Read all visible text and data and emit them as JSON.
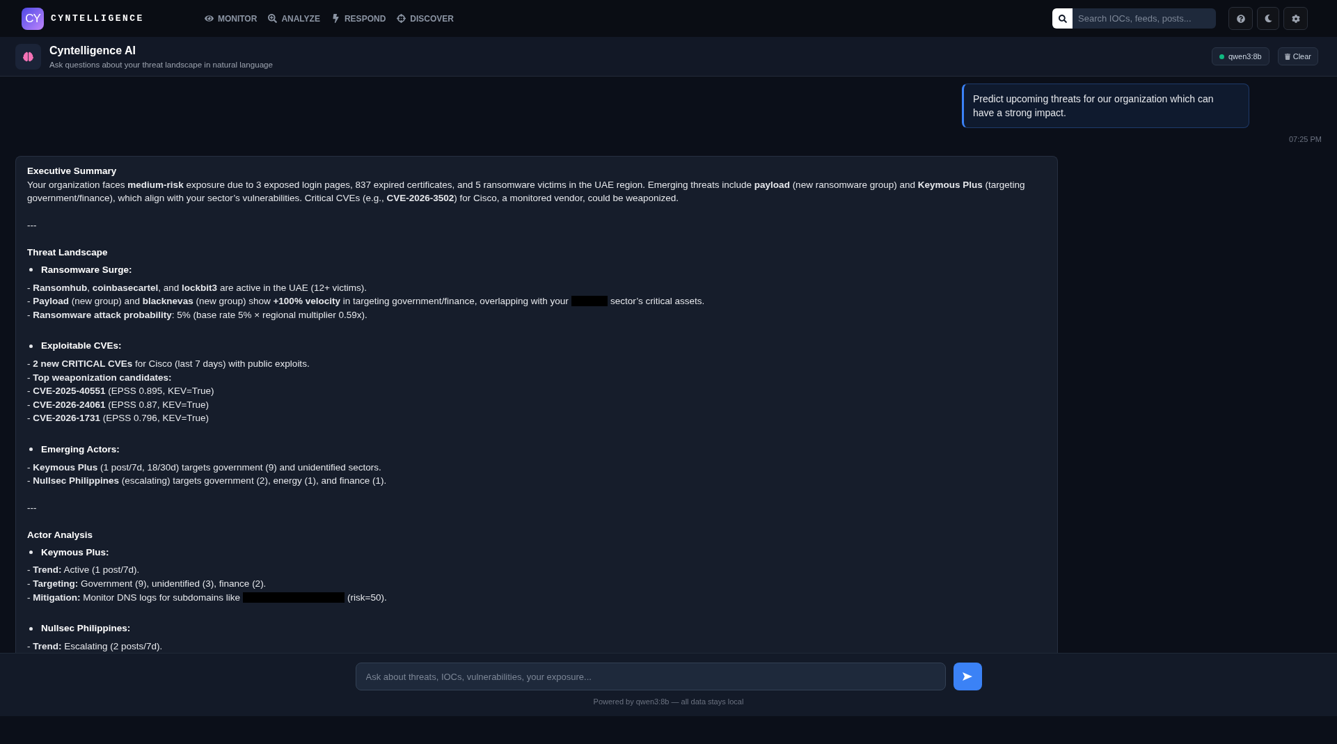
{
  "nav": {
    "logo_text": "CY",
    "brand": "CYNTELLIGENCE",
    "items": [
      {
        "label": "MONITOR"
      },
      {
        "label": "ANALYZE"
      },
      {
        "label": "RESPOND"
      },
      {
        "label": "DISCOVER"
      }
    ],
    "search": {
      "placeholder": "Search IOCs, feeds, posts..."
    }
  },
  "assistant_header": {
    "title": "Cyntelligence AI",
    "subtitle": "Ask questions about your threat landscape in natural language",
    "model_badge": {
      "label": "qwen3:8b",
      "online": true
    },
    "clear_button": "Clear"
  },
  "chat": {
    "messages": [
      {
        "kind": "user",
        "text": "Predict upcoming threats for our organization which can have a strong impact.",
        "time": "07:25 PM"
      },
      {
        "kind": "assistant",
        "blocks": [
          {
            "kind": "heading",
            "text": "Executive Summary"
          },
          {
            "kind": "paragraph",
            "text": "Your organization faces **medium-risk** exposure due to 3 exposed login pages, 837 expired certificates, and 5 ransomware victims in the UAE region. Emerging threats include **payload** (new ransomware group) and **Keymous Plus** (targeting government/finance), which align with your sector’s vulnerabilities. Critical CVEs (e.g., **CVE-2026-3502**) for Cisco, a monitored vendor, could be weaponized."
          },
          {
            "kind": "rule",
            "text": "---"
          },
          {
            "kind": "heading",
            "text": "Threat Landscape"
          },
          {
            "kind": "bullet",
            "text": "Ransomware Surge:"
          },
          {
            "kind": "lines",
            "lines": [
              {
                "text": "- **Ransomhub**, **coinbasecartel**, and **lockbit3** are active in the UAE (12+ victims)."
              },
              {
                "text": "- **Payload** (new group) and **blacknevas** (new group) show **+100% velocity** in targeting government/finance, overlapping with your",
                "redacted": true,
                "after": "sector’s critical assets."
              },
              {
                "text": "- **Ransomware attack probability**: 5% (base rate 5% × regional multiplier 0.59x)."
              }
            ]
          },
          {
            "kind": "bullet",
            "text": "Exploitable CVEs:"
          },
          {
            "kind": "lines",
            "lines": [
              {
                "text": "- **2 new CRITICAL CVEs** for Cisco (last 7 days) with public exploits."
              },
              {
                "text": "- **Top weaponization candidates:**"
              },
              {
                "text": "- **CVE-2025-40551** (EPSS 0.895, KEV=True)"
              },
              {
                "text": "- **CVE-2026-24061** (EPSS 0.87, KEV=True)"
              },
              {
                "text": "- **CVE-2026-1731** (EPSS 0.796, KEV=True)"
              }
            ]
          },
          {
            "kind": "bullet",
            "text": "Emerging Actors:"
          },
          {
            "kind": "lines",
            "lines": [
              {
                "text": "- **Keymous Plus** (1 post/7d, 18/30d) targets government (9) and unidentified sectors."
              },
              {
                "text": "- **Nullsec Philippines** (escalating) targets government (2), energy (1), and finance (1)."
              }
            ]
          },
          {
            "kind": "rule",
            "text": "---"
          },
          {
            "kind": "heading",
            "text": "Actor Analysis"
          },
          {
            "kind": "bullet",
            "text": "Keymous Plus:"
          },
          {
            "kind": "lines",
            "lines": [
              {
                "text": "- **Trend:** Active (1 post/7d)."
              },
              {
                "text": "- **Targeting:** Government (9), unidentified (3), finance (2)."
              },
              {
                "text": "- **Mitigation:** Monitor DNS logs for subdomains like",
                "redacted": true,
                "after": "(risk=50)."
              }
            ]
          },
          {
            "kind": "bullet",
            "text": "Nullsec Philippines:"
          },
          {
            "kind": "lines",
            "lines": [
              {
                "text": "- **Trend:** Escalating (2 posts/7d)."
              }
            ]
          }
        ]
      }
    ]
  },
  "composer": {
    "placeholder": "Ask about threats, IOCs, vulnerabilities, your exposure...",
    "footer": "Powered by qwen3:8b — all data stays local"
  }
}
